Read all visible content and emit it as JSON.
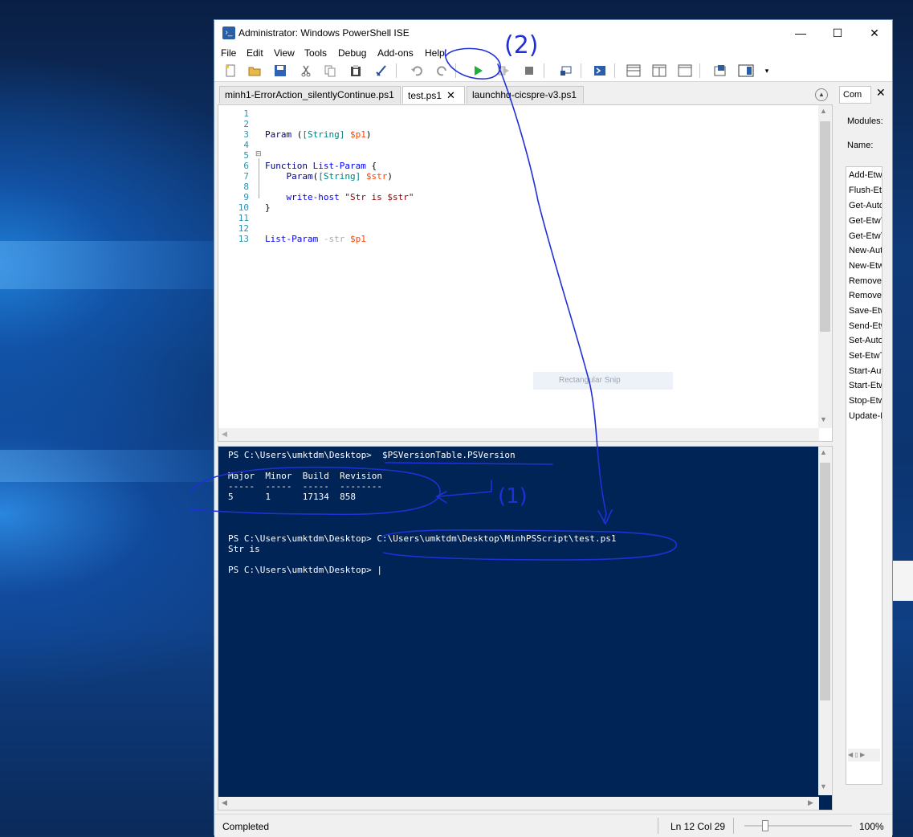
{
  "window": {
    "title": "Administrator: Windows PowerShell ISE",
    "minimize": "—",
    "maximize": "☐",
    "close": "✕"
  },
  "menu": [
    "File",
    "Edit",
    "View",
    "Tools",
    "Debug",
    "Add-ons",
    "Help"
  ],
  "toolbar_icons": [
    "new-icon",
    "open-icon",
    "save-icon",
    "cut-icon",
    "copy-icon",
    "paste-icon",
    "clear-console-icon",
    "undo-icon",
    "redo-icon",
    "run-script-icon",
    "run-selection-icon",
    "stop-icon",
    "new-remote-tab-icon",
    "start-powershell-icon",
    "show-script-pane-top-icon",
    "show-script-pane-right-icon",
    "show-script-pane-max-icon",
    "show-command-window-icon",
    "show-command-addon-icon"
  ],
  "tabs": [
    {
      "label": "minh1-ErrorAction_silentlyContinue.ps1",
      "active": false
    },
    {
      "label": "test.ps1",
      "active": true,
      "close": "✕"
    },
    {
      "label": "launchhq-cicspre-v3.ps1",
      "active": false
    }
  ],
  "editor": {
    "line_numbers": [
      "1",
      "2",
      "3",
      "4",
      "5",
      "6",
      "7",
      "8",
      "9",
      "10",
      "11",
      "12",
      "13"
    ],
    "code": {
      "l2_kw": "Param ",
      "l2_a": "(",
      "l2_type": "[String]",
      "l2_b": " ",
      "l2_var": "$p1",
      "l2_c": ")",
      "l5_fold": "⊟",
      "l5_kw": "Function ",
      "l5_name": "List-Param",
      "l5_brace": " {",
      "l6_kw": "    Param",
      "l6_a": "(",
      "l6_type": "[String]",
      "l6_b": " ",
      "l6_var": "$str",
      "l6_c": ")",
      "l8_cmd": "    write-host ",
      "l8_str": "\"Str is $str\"",
      "l9_brace": "}",
      "l12_cmd": "List-Param ",
      "l12_param": "-str ",
      "l12_var": "$p1"
    }
  },
  "console": {
    "lines": [
      "PS C:\\Users\\umktdm\\Desktop>  $PSVersionTable.PSVersion",
      "",
      "Major  Minor  Build  Revision",
      "-----  -----  -----  --------",
      "5      1      17134  858",
      "",
      "",
      "",
      "PS C:\\Users\\umktdm\\Desktop> C:\\Users\\umktdm\\Desktop\\MinhPSScript\\test.ps1",
      "Str is",
      "",
      "PS C:\\Users\\umktdm\\Desktop> |"
    ]
  },
  "commands_pane": {
    "tab_label": "Com",
    "close": "✕",
    "modules_label": "Modules:",
    "name_label": "Name:",
    "items": [
      "Add-Etw",
      "Flush-Etw",
      "Get-Auto",
      "Get-EtwT",
      "Get-EtwT",
      "New-Aut",
      "New-Etw",
      "Remove-",
      "Remove-",
      "Save-Etw",
      "Send-Etw",
      "Set-Auto",
      "Set-EtwT",
      "Start-Aut",
      "Start-Etw",
      "Stop-Etw",
      "Update-I"
    ]
  },
  "status": {
    "state": "Completed",
    "position": "Ln 12  Col 29",
    "zoom": "100%"
  },
  "overlay": {
    "snip_label": "Rectangular Snip"
  },
  "annotations": {
    "label_1": "(1)",
    "label_2": "(2)",
    "color": "#2030d8"
  }
}
